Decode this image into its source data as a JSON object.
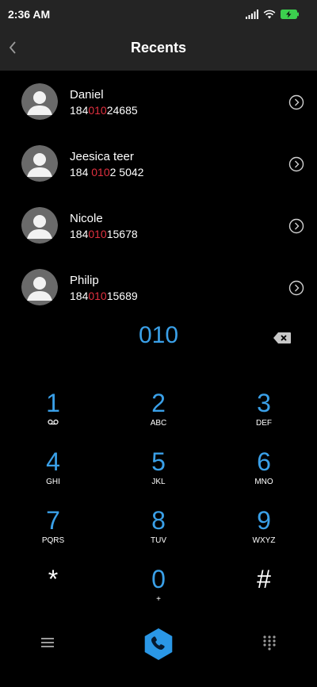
{
  "status_bar": {
    "time": "2:36 AM"
  },
  "header": {
    "title": "Recents"
  },
  "contacts": [
    {
      "name": "Daniel",
      "number_pre": "184",
      "number_match": "010",
      "number_post": "24685"
    },
    {
      "name": "Jeesica teer",
      "number_pre": "184 ",
      "number_match": "010",
      "number_post": "2 5042"
    },
    {
      "name": "Nicole",
      "number_pre": "184",
      "number_match": "010",
      "number_post": "15678"
    },
    {
      "name": "Philip",
      "number_pre": "184",
      "number_match": "010",
      "number_post": "15689"
    }
  ],
  "dialer": {
    "query": "010"
  },
  "keypad": {
    "keys": [
      {
        "digit": "1",
        "sub": ""
      },
      {
        "digit": "2",
        "sub": "ABC"
      },
      {
        "digit": "3",
        "sub": "DEF"
      },
      {
        "digit": "4",
        "sub": "GHI"
      },
      {
        "digit": "5",
        "sub": "JKL"
      },
      {
        "digit": "6",
        "sub": "MNO"
      },
      {
        "digit": "7",
        "sub": "PQRS"
      },
      {
        "digit": "8",
        "sub": "TUV"
      },
      {
        "digit": "9",
        "sub": "WXYZ"
      },
      {
        "digit": "*",
        "sub": ""
      },
      {
        "digit": "0",
        "sub": "+"
      },
      {
        "digit": "#",
        "sub": ""
      }
    ]
  },
  "icons": {
    "back": "back-arrow-icon",
    "detail": "chevron-circle-icon",
    "backspace": "backspace-icon",
    "voicemail": "voicemail-icon",
    "menu": "menu-icon",
    "call": "phone-icon",
    "dialpad": "dialpad-icon",
    "signal": "signal-icon",
    "wifi": "wifi-icon",
    "battery": "battery-icon"
  },
  "colors": {
    "accent": "#3aa0e8",
    "highlight": "#e0303f",
    "background": "#000000",
    "header_bg": "#242424"
  }
}
